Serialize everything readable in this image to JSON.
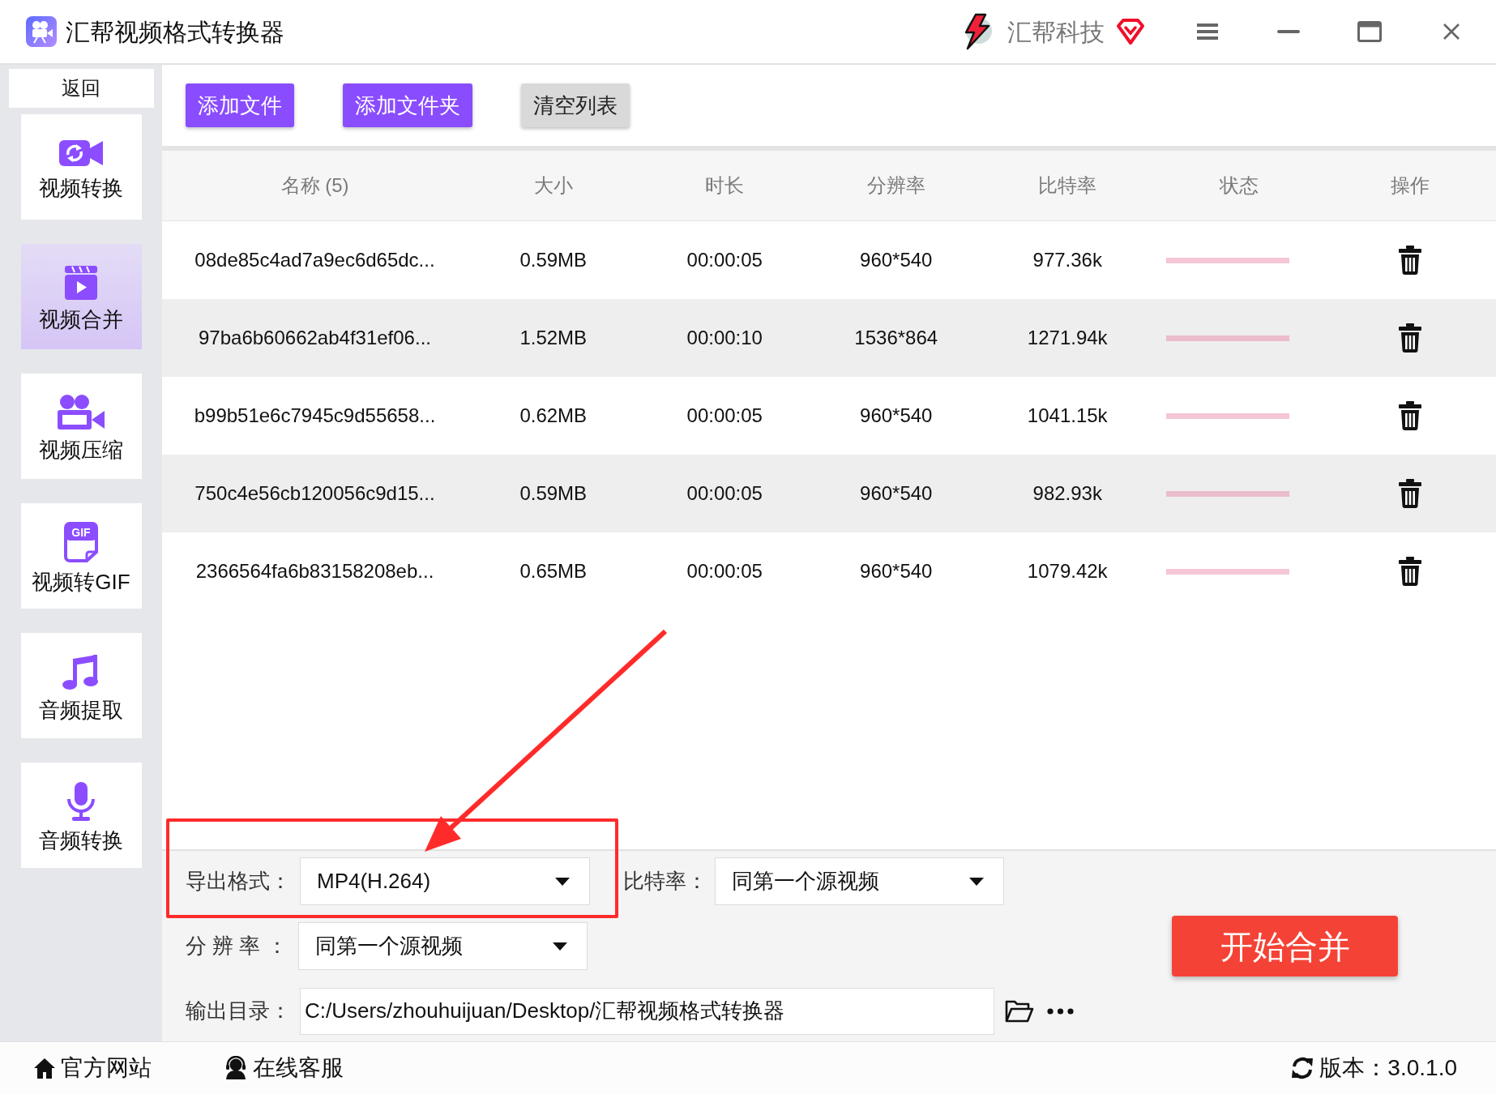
{
  "window": {
    "title": "汇帮视频格式转换器",
    "brand": "汇帮科技"
  },
  "sidebar": {
    "back": "返回",
    "items": [
      {
        "label": "视频转换",
        "selected": false
      },
      {
        "label": "视频合并",
        "selected": true
      },
      {
        "label": "视频压缩",
        "selected": false
      },
      {
        "label": "视频转GIF",
        "selected": false,
        "icon_text": "GIF"
      },
      {
        "label": "音频提取",
        "selected": false
      },
      {
        "label": "音频转换",
        "selected": false
      }
    ]
  },
  "toolbar": {
    "buttons": [
      {
        "label": "添加文件",
        "kind": "primary"
      },
      {
        "label": "添加文件夹",
        "kind": "primary"
      },
      {
        "label": "清空列表",
        "kind": "secondary"
      }
    ]
  },
  "table": {
    "columns": [
      "名称 (5)",
      "大小",
      "时长",
      "分辨率",
      "比特率",
      "状态",
      "操作"
    ],
    "rows": [
      {
        "cells": [
          "08de85c4ad7a9ec6d65dc...",
          "0.59MB",
          "00:00:05",
          "960*540",
          "977.36k"
        ]
      },
      {
        "cells": [
          "97ba6b60662ab4f31ef06...",
          "1.52MB",
          "00:00:10",
          "1536*864",
          "1271.94k"
        ]
      },
      {
        "cells": [
          "b99b51e6c7945c9d55658...",
          "0.62MB",
          "00:00:05",
          "960*540",
          "1041.15k"
        ]
      },
      {
        "cells": [
          "750c4e56cb120056c9d15...",
          "0.59MB",
          "00:00:05",
          "960*540",
          "982.93k"
        ]
      },
      {
        "cells": [
          "2366564fa6b83158208eb...",
          "0.65MB",
          "00:00:05",
          "960*540",
          "1079.42k"
        ]
      }
    ]
  },
  "settings": {
    "format": {
      "label": "导出格式：",
      "value": "MP4(H.264)"
    },
    "bitrate": {
      "label": "比特率：",
      "value": "同第一个源视频"
    },
    "resolution": {
      "label": "分 辨 率 ：",
      "value": "同第一个源视频"
    },
    "output_dir": {
      "label": "输出目录：",
      "value": "C:/Users/zhouhuijuan/Desktop/汇帮视频格式转换器"
    },
    "start_button": "开始合并"
  },
  "footer": {
    "links": [
      "官方网站",
      "在线客服"
    ],
    "version": "版本：3.0.1.0"
  }
}
